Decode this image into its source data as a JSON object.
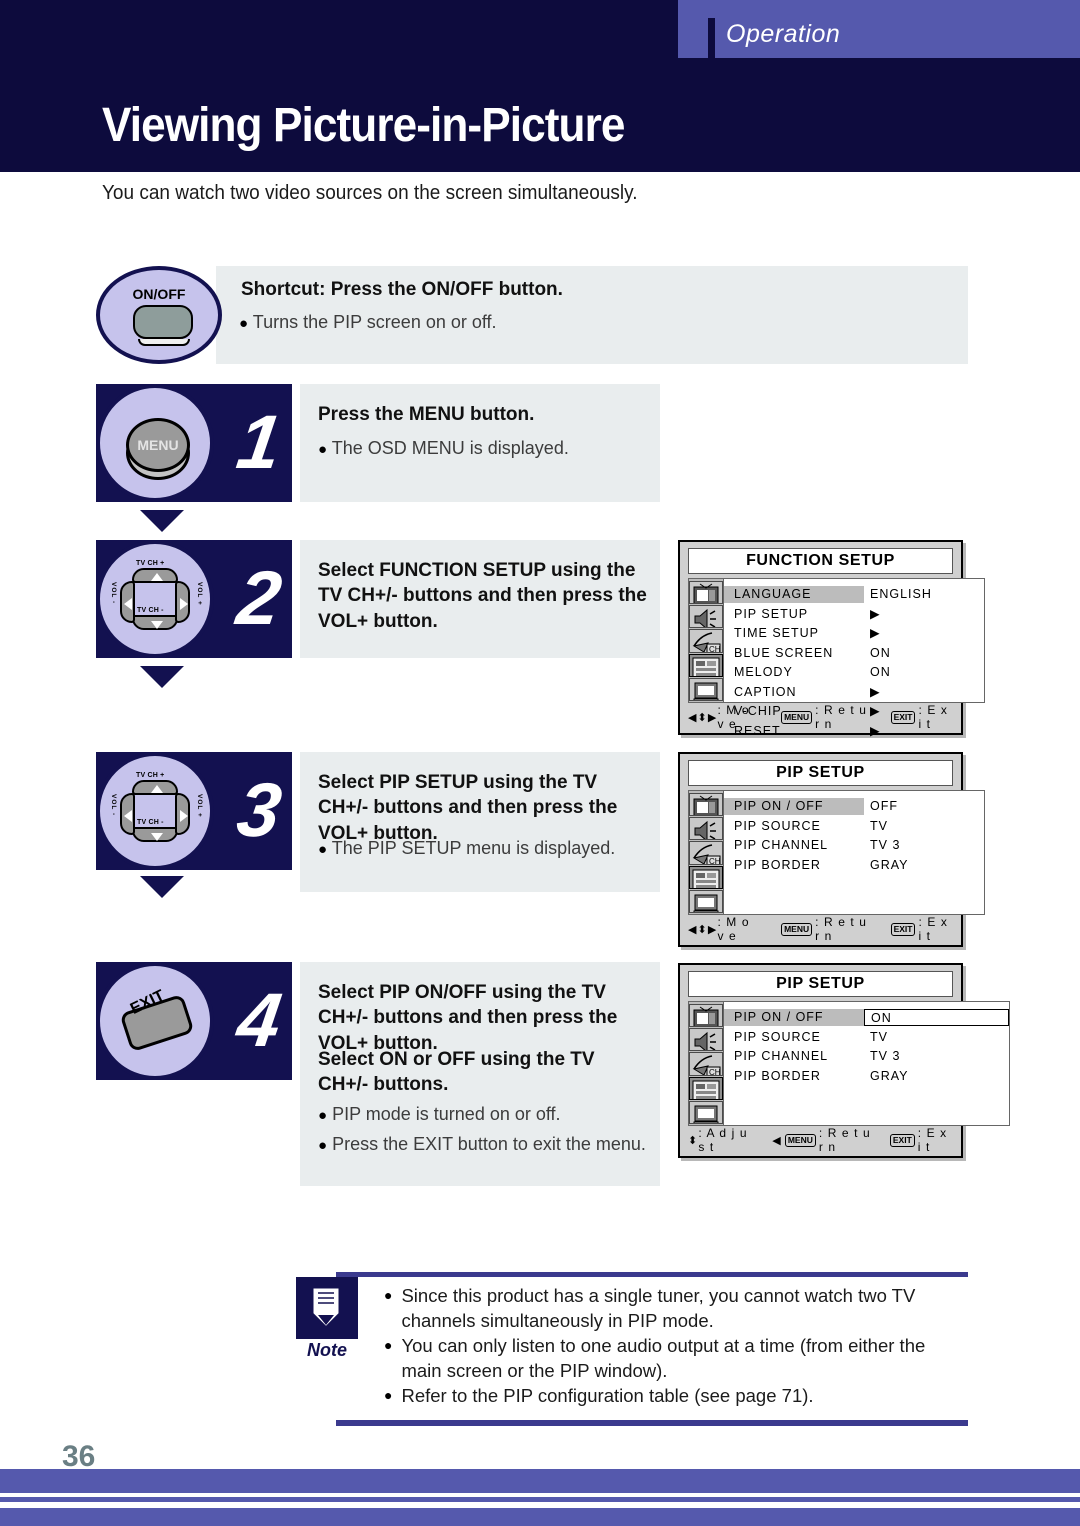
{
  "header": {
    "section_label": "Operation",
    "title": "Viewing Picture-in-Picture",
    "intro": "You can watch two video sources on the screen simultaneously."
  },
  "shortcut": {
    "key_label": "ON/OFF",
    "title": "Shortcut: Press the ON/OFF button.",
    "bullet": "Turns the PIP screen on or off."
  },
  "steps": [
    {
      "number": "1",
      "key_label": "MENU",
      "heading": "Press the MENU button.",
      "bullets": [
        "The OSD MENU is displayed."
      ]
    },
    {
      "number": "2",
      "key_label": "",
      "heading": "Select FUNCTION SETUP using the TV CH+/- buttons and then press the VOL+ button.",
      "bullets": []
    },
    {
      "number": "3",
      "key_label": "",
      "heading": "Select PIP SETUP using the TV CH+/- buttons and then press the VOL+ button.",
      "bullets": [
        "The PIP SETUP menu is displayed."
      ]
    },
    {
      "number": "4",
      "key_label": "EXIT",
      "heading": "Select PIP ON/OFF using the TV CH+/- buttons and then press the VOL+ button.",
      "heading2": "Select ON or OFF using the TV CH+/- buttons.",
      "bullets": [
        "PIP mode is turned on or off.",
        "Press the EXIT button to exit the menu."
      ]
    }
  ],
  "dpad": {
    "up_label": "TV CH +",
    "down_label": "TV CH -",
    "left_label": "VOL -",
    "right_label": "VOL +"
  },
  "osd_panels": [
    {
      "title": "FUNCTION SETUP",
      "rows": [
        {
          "label": "LANGUAGE",
          "value": "ENGLISH",
          "highlight": true,
          "boxed": false
        },
        {
          "label": "PIP SETUP",
          "value": "▶",
          "highlight": false,
          "boxed": false
        },
        {
          "label": "TIME SETUP",
          "value": "▶",
          "highlight": false,
          "boxed": false
        },
        {
          "label": "BLUE SCREEN",
          "value": "ON",
          "highlight": false,
          "boxed": false
        },
        {
          "label": "MELODY",
          "value": "ON",
          "highlight": false,
          "boxed": false
        },
        {
          "label": "CAPTION",
          "value": "▶",
          "highlight": false,
          "boxed": false
        },
        {
          "label": "V-CHIP",
          "value": "▶",
          "highlight": false,
          "boxed": false
        },
        {
          "label": "RESET",
          "value": "▶",
          "highlight": false,
          "boxed": false
        }
      ],
      "footer": {
        "nav_glyph": "◀⬍▶",
        "nav_text": ": M o v e",
        "menu_key": "MENU",
        "menu_text": ": R e t u r n",
        "exit_key": "EXIT",
        "exit_text": ": E x i t",
        "pre_menu_arrow": ""
      }
    },
    {
      "title": "PIP SETUP",
      "rows": [
        {
          "label": "PIP ON / OFF",
          "value": "OFF",
          "highlight": true,
          "boxed": false
        },
        {
          "label": "PIP SOURCE",
          "value": "TV",
          "highlight": false,
          "boxed": false
        },
        {
          "label": "PIP CHANNEL",
          "value": "TV 3",
          "highlight": false,
          "boxed": false
        },
        {
          "label": "PIP BORDER",
          "value": "GRAY",
          "highlight": false,
          "boxed": false
        }
      ],
      "footer": {
        "nav_glyph": "◀⬍▶",
        "nav_text": ": M o v e",
        "menu_key": "MENU",
        "menu_text": ": R e t u r n",
        "exit_key": "EXIT",
        "exit_text": ": E x i t",
        "pre_menu_arrow": ""
      }
    },
    {
      "title": "PIP SETUP",
      "rows": [
        {
          "label": "PIP ON / OFF",
          "value": "ON",
          "highlight": true,
          "boxed": true
        },
        {
          "label": "PIP SOURCE",
          "value": "TV",
          "highlight": false,
          "boxed": false
        },
        {
          "label": "PIP CHANNEL",
          "value": "TV 3",
          "highlight": false,
          "boxed": false
        },
        {
          "label": "PIP BORDER",
          "value": "GRAY",
          "highlight": false,
          "boxed": false
        }
      ],
      "footer": {
        "nav_glyph": "⬍",
        "nav_text": ": A d j u s t",
        "menu_key": "MENU",
        "menu_text": ": R e t u r n",
        "exit_key": "EXIT",
        "exit_text": ": E x i t",
        "pre_menu_arrow": "◀"
      }
    }
  ],
  "note": {
    "label": "Note",
    "items": [
      "Since this product has a single tuner, you cannot watch two TV channels simultaneously in PIP mode.",
      "You can only listen to one audio output at a time (from either the main screen or the PIP window).",
      "Refer to the PIP configuration table (see page 71)."
    ]
  },
  "footer": {
    "page_number": "36"
  },
  "colors": {
    "dark_navy": "#131150",
    "header_navy": "#0d0b3d",
    "accent_purple": "#5559ad",
    "key_lilac": "#c6c3ec",
    "panel_gray": "#e9edee"
  }
}
